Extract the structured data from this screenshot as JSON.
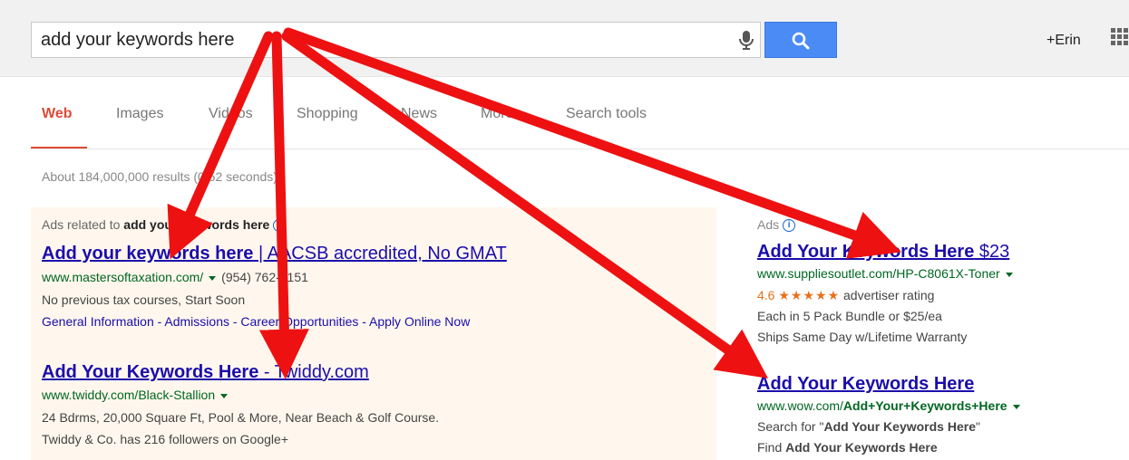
{
  "search": {
    "query": "add your keywords here"
  },
  "header": {
    "user": "+Erin"
  },
  "tabs": [
    {
      "label": "Web",
      "active": true
    },
    {
      "label": "Images"
    },
    {
      "label": "Videos"
    },
    {
      "label": "Shopping"
    },
    {
      "label": "News"
    },
    {
      "label": "More"
    },
    {
      "label": "Search tools"
    }
  ],
  "stats": "About 184,000,000 results (0.52 seconds)",
  "left_ads": {
    "header_prefix": "Ads related to ",
    "header_query": "add your keywords here",
    "ads": [
      {
        "title_bold": "Add your keywords here",
        "title_rest": " | AACSB accredited, No GMAT",
        "url": "www.mastersoftaxation.com/",
        "phone": "(954) 762-5151",
        "line1": "No previous tax courses, Start Soon",
        "links": "General Information - Admissions - Career Opportunities - Apply Online Now"
      },
      {
        "title_bold": "Add Your Keywords Here",
        "title_rest": " - Twiddy.com",
        "url": "www.twiddy.com/Black-Stallion",
        "line1": "24 Bdrms, 20,000 Square Ft, Pool & More, Near Beach & Golf Course.",
        "line2": "Twiddy & Co. has 216 followers on Google+"
      }
    ]
  },
  "right_ads": {
    "header": "Ads",
    "ads": [
      {
        "title_bold": "Add Your Keywords Here",
        "title_rest": " $23",
        "url": "www.suppliesoutlet.com/HP-C8061X-Toner",
        "rating": "4.6",
        "stars": "★★★★★",
        "rating_text": "advertiser rating",
        "line1": "Each in 5 Pack Bundle or $25/ea",
        "line2": "Ships Same Day w/Lifetime Warranty"
      },
      {
        "title_bold": "Add Your Keywords Here",
        "url_prefix": "www.wow.com/",
        "url_bold": "Add+Your+Keywords+Here",
        "line1_prefix": "Search for \"",
        "line1_bold": "Add Your Keywords Here",
        "line1_suffix": "\"",
        "line2_prefix": "Find ",
        "line2_bold": "Add Your Keywords Here"
      }
    ]
  },
  "colors": {
    "accent": "#dd4b39",
    "link": "#1a0dab",
    "url": "#006621",
    "arrow": "#ee1111",
    "ad_bg": "#fff7ed",
    "search_button": "#4b8bf5"
  }
}
